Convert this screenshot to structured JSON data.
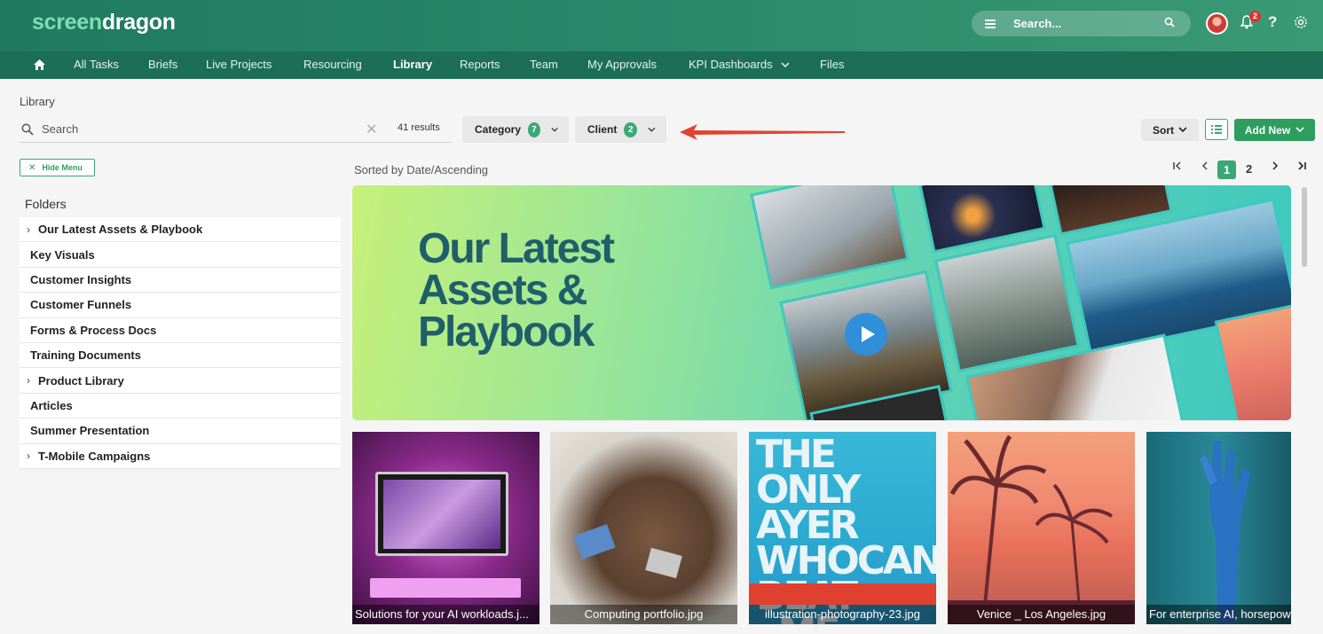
{
  "app": {
    "logo_part1": "screen",
    "logo_part2": "dragon",
    "search_placeholder": "Search...",
    "notification_count": "2",
    "help_label": "?"
  },
  "nav": {
    "items": [
      "All Tasks",
      "Briefs",
      "Live Projects",
      "Resourcing",
      "Library",
      "Reports",
      "Team",
      "My Approvals",
      "KPI Dashboards",
      "Files"
    ],
    "active": "Library"
  },
  "page": {
    "breadcrumb": "Library",
    "search_placeholder": "Search",
    "results": "41 results",
    "filters": [
      {
        "label": "Category",
        "count": "7"
      },
      {
        "label": "Client",
        "count": "2"
      }
    ],
    "sort_label": "Sort",
    "add_new_label": "Add New",
    "hide_menu_label": "Hide Menu",
    "sorted_by": "Sorted by Date/Ascending",
    "pages": [
      "1",
      "2"
    ],
    "current_page": "1"
  },
  "sidebar": {
    "title": "Folders",
    "folders": [
      {
        "label": "Our Latest Assets & Playbook",
        "expandable": true
      },
      {
        "label": "Key Visuals",
        "expandable": false
      },
      {
        "label": "Customer Insights",
        "expandable": false
      },
      {
        "label": "Customer Funnels",
        "expandable": false
      },
      {
        "label": "Forms & Process Docs",
        "expandable": false
      },
      {
        "label": "Training Documents",
        "expandable": false
      },
      {
        "label": "Product Library",
        "expandable": true
      },
      {
        "label": "Articles",
        "expandable": false
      },
      {
        "label": "Summer Presentation",
        "expandable": false
      },
      {
        "label": "T-Mobile Campaigns",
        "expandable": true
      }
    ]
  },
  "hero": {
    "title": "Our Latest\nAssets &\nPlaybook"
  },
  "assets": [
    {
      "name": "Solutions for your AI workloads.j..."
    },
    {
      "name": "Computing portfolio.jpg"
    },
    {
      "name": "illustration-photography-23.jpg"
    },
    {
      "name": "Venice _ Los Angeles.jpg"
    },
    {
      "name": "For enterprise AI, horsepow"
    }
  ],
  "colors": {
    "header": "#1f7a5e",
    "nav": "#1c6e55",
    "accent": "#3aa876",
    "add_button": "#2e9e5e",
    "arrow": "#e0452f"
  }
}
